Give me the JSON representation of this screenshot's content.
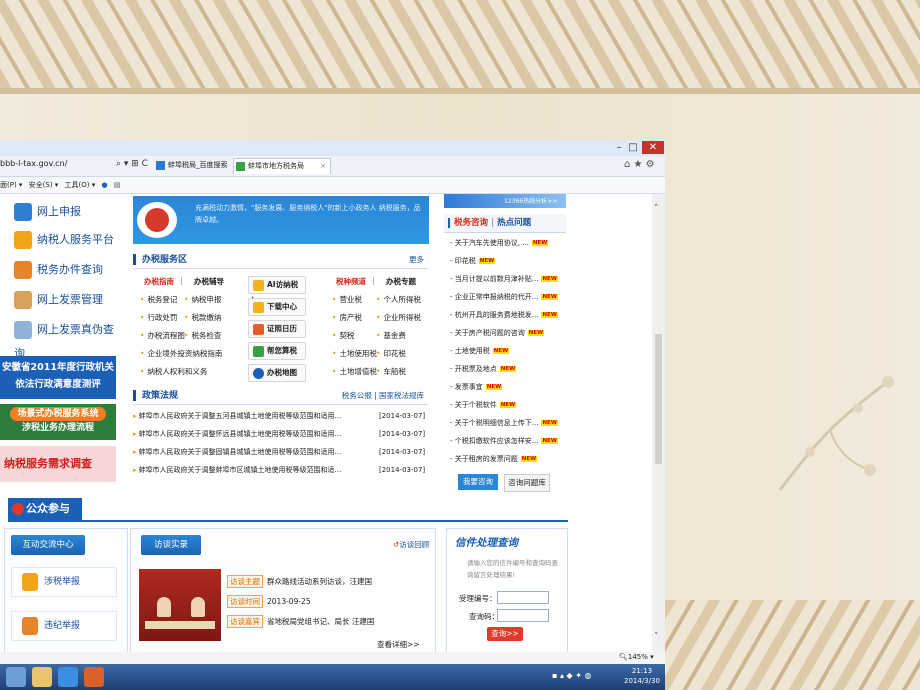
{
  "browser": {
    "window_controls": {
      "minimize": "–",
      "maximize": "□",
      "close": "✕"
    },
    "url": "bbb-l-tax.gov.cn/",
    "addr_icons": "⌕ ▾ ⊞ C",
    "tabs": [
      {
        "label": "蚌埠税局_百度搜索"
      },
      {
        "label": "蚌埠市地方税务局",
        "close": "×"
      }
    ],
    "right_icons": "⌂ ★ ⚙",
    "command_bar": [
      "面(P) ▾",
      "安全(S) ▾",
      "工具(O) ▾"
    ],
    "zoom": "145%",
    "scroll_up": "˄",
    "scroll_down": "˅"
  },
  "left_nav": {
    "items": [
      {
        "label": "网上申报",
        "icon": "pen-icon"
      },
      {
        "label": "纳税人服务平台",
        "icon": "people-icon"
      },
      {
        "label": "税务办件查询",
        "icon": "hand-icon"
      },
      {
        "label": "网上发票管理",
        "icon": "document-icon"
      },
      {
        "label": "网上发票真伪查询",
        "icon": "magnifier-icon"
      }
    ],
    "banner1_line1": "安徽省2011年度行政机关",
    "banner1_line2": "依法行政满意度测评",
    "banner2_line1": "场景式办税服务系统",
    "banner2_line2": "涉税业务办理流程",
    "banner3": "纳税服务需求调查"
  },
  "hero_text": "充满税动力激情，\"服务发展、服务纳税人\"的新上小政务人 纳税服务，品牌卓越。",
  "tax_service": {
    "heading": "办税服务区",
    "more": "更多",
    "col1_title": "办税指南",
    "col2_title": "办税辅导",
    "col3_title": "税种频道",
    "col4_title": "办税专题",
    "col1": [
      "税务登记",
      "行政处罚",
      "办税流程图",
      "企业境外投资纳税指南",
      "纳税人权利和义务"
    ],
    "col2": [
      "纳税申报",
      "税款缴纳",
      "税务检查"
    ],
    "buttons": [
      "AI访纳税人",
      "下载中心",
      "证照日历",
      "帮您算税",
      "办税地图"
    ],
    "col3": [
      "营业税",
      "房产税",
      "契税",
      "土地使用税",
      "土地增值税"
    ],
    "col4": [
      "个人所得税",
      "企业所得税",
      "基金费",
      "印花税",
      "车船税"
    ]
  },
  "policy": {
    "heading": "政策法规",
    "links": "税务公报 | 国家税法规库",
    "items": [
      {
        "title": "蚌埠市人民政府关于调整五河县城镇土地使用税等级范围和适用...",
        "date": "[2014-03-07]"
      },
      {
        "title": "蚌埠市人民政府关于调整怀远县城镇土地使用税等级范围和适用...",
        "date": "[2014-03-07]"
      },
      {
        "title": "蚌埠市人民政府关于调整固镇县城镇土地使用税等级范围和适用...",
        "date": "[2014-03-07]"
      },
      {
        "title": "蚌埠市人民政府关于调整蚌埠市区城镇土地使用税等级范围和适...",
        "date": "[2014-03-07]"
      }
    ]
  },
  "right_panel": {
    "top_strip": "12366热线分析>>",
    "heading_a": "税务咨询",
    "heading_sep": "|",
    "heading_b": "热点问题",
    "new_tag": "NEW",
    "items": [
      "关于汽车先使用协议, ...",
      "印花税",
      "当月计提以前数月津补贴...",
      "企业正常申报纳税的代开...",
      "杭州开具的服务费地税发...",
      "关于房产税问题的咨询",
      "土地使用税",
      "开税票及地点",
      "发票事宜",
      "关于个税软件",
      "关于个税明细信息上传下...",
      "个税扣缴软件应该怎样安...",
      "关于租房的发票问题"
    ],
    "btn_consult": "我要咨询",
    "btn_library": "咨询问题库"
  },
  "public": {
    "title": "公众参与",
    "interact_tab": "互动交流中心",
    "items": [
      "涉税举报",
      "违纪举报"
    ],
    "interview_tab": "访谈实录",
    "interview_more": "访谈回顾",
    "interview": {
      "k1": "访谈主题",
      "v1": "群众路线活动系列访谈，汪建国",
      "k2": "访谈时间",
      "v2": "2013-09-25",
      "k3": "访谈嘉宾",
      "v3": "省地税局党组书记、局长 汪建国",
      "detail": "查看详细>>"
    },
    "query": {
      "title": "信件处理查询",
      "hint": "请输入您的信件编号和查询码查询留言处理结果!",
      "label_no": "受理编号：",
      "label_code": "查询码：",
      "button": "查询>>"
    }
  },
  "taskbar": {
    "tray": "▪ ▴ ◆ ✦ ◍",
    "time": "21:13",
    "date": "2014/3/30"
  },
  "colors": {
    "accent": "#1a5fb8",
    "nav_text": "#1a4f9c",
    "red": "#d2281c",
    "new_tag": "#ffdc00",
    "taskbar": "#2a4f8a"
  }
}
